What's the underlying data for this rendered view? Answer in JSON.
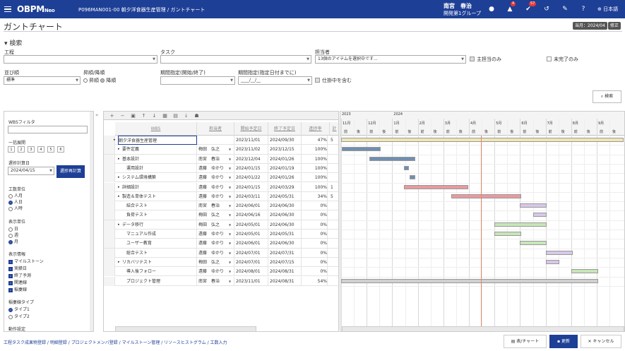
{
  "header": {
    "logo": "OBPM",
    "logo_suffix": "Neo",
    "breadcrumb": "P096MAN001-00 朝夕洋食器生産管理 / ガントチャート",
    "user_name": "南宮　春治",
    "user_group": "開発第1グループ",
    "badge_bell": "4",
    "badge_check": "57",
    "language": "日本語",
    "accent": "#1e3f96"
  },
  "page": {
    "title": "ガントチャート",
    "current_badge": "当月：2024/04",
    "fix_badge": "修正"
  },
  "search": {
    "section_title": "検索",
    "labels": {
      "process": "工程",
      "task": "タスク",
      "assignee": "担当者",
      "order": "並び順",
      "asc_desc": "昇順/降順",
      "period_range": "期間指定(開始/終了)",
      "period_date": "期間指定(指定日付までに)"
    },
    "assignee_value": "13個のアイテムを選択中です...",
    "only_mine": "主担当のみ",
    "only_incomplete": "未完了のみ",
    "order_value": "標準",
    "asc": "昇順",
    "desc": "降順",
    "date_placeholder": "____/__/__",
    "include_wip": "仕掛中を含む",
    "search_button": "検索"
  },
  "side": {
    "wbs_filter": "WBSフィルタ",
    "expand_all": "一括展開",
    "levels": [
      "1",
      "2",
      "3",
      "4",
      "5",
      "6"
    ],
    "delay_date_label": "遅捗計算日",
    "delay_date": "2024/04/15",
    "recalc": "遅捗再計算",
    "unit_label": "工数単位",
    "units": [
      "人月",
      "人日",
      "人時"
    ],
    "display_unit_label": "表示単位",
    "display_units": [
      "日",
      "週",
      "月"
    ],
    "display_info_label": "表示情報",
    "display_info": [
      "マイルストーン",
      "実績日",
      "終了予測",
      "関連線",
      "稲妻線"
    ],
    "lightning_label": "稲妻線タイプ",
    "lightning_types": [
      "タイプ1",
      "タイプ2"
    ],
    "action_settings": "動作設定"
  },
  "grid": {
    "columns": [
      "WBS",
      "担当者",
      "開始予定日",
      "終了予定日",
      "進捗率",
      "計"
    ],
    "rows": [
      {
        "wbs": "朝夕洋食器生産管理",
        "assignee": "",
        "start": "2023/11/01",
        "end": "2024/09/30",
        "progress": "47%",
        "extra": "5"
      },
      {
        "wbs": "要件定義",
        "assignee": "梅田　弘之",
        "start": "2023/11/02",
        "end": "2023/12/15",
        "progress": "100%",
        "extra": ""
      },
      {
        "wbs": "基本設計",
        "assignee": "南宮　春治",
        "start": "2023/12/04",
        "end": "2024/01/26",
        "progress": "100%",
        "extra": ""
      },
      {
        "wbs": "運用設計",
        "assignee": "遠藤　ゆかり",
        "start": "2024/01/15",
        "end": "2024/01/19",
        "progress": "100%",
        "extra": ""
      },
      {
        "wbs": "システム環境構築",
        "assignee": "遠藤　ゆかり",
        "start": "2024/01/22",
        "end": "2024/01/26",
        "progress": "100%",
        "extra": ""
      },
      {
        "wbs": "詳細設計",
        "assignee": "遠藤　ゆかり",
        "start": "2024/01/15",
        "end": "2024/03/29",
        "progress": "100%",
        "extra": "1"
      },
      {
        "wbs": "製造＆単体テスト",
        "assignee": "遠藤　ゆかり",
        "start": "2024/03/11",
        "end": "2024/05/31",
        "progress": "34%",
        "extra": "5"
      },
      {
        "wbs": "結合テスト",
        "assignee": "南宮　春治",
        "start": "2024/06/01",
        "end": "2024/06/30",
        "progress": "0%",
        "extra": ""
      },
      {
        "wbs": "負荷テスト",
        "assignee": "梅田　弘之",
        "start": "2024/06/16",
        "end": "2024/06/30",
        "progress": "0%",
        "extra": ""
      },
      {
        "wbs": "データ移行",
        "assignee": "梅田　弘之",
        "start": "2024/05/01",
        "end": "2024/06/30",
        "progress": "0%",
        "extra": ""
      },
      {
        "wbs": "マニュアル作成",
        "assignee": "遠藤　ゆかり",
        "start": "2024/05/01",
        "end": "2024/05/31",
        "progress": "0%",
        "extra": ""
      },
      {
        "wbs": "ユーザー教育",
        "assignee": "遠藤　ゆかり",
        "start": "2024/06/01",
        "end": "2024/06/30",
        "progress": "0%",
        "extra": ""
      },
      {
        "wbs": "総合テスト",
        "assignee": "遠藤　ゆかり",
        "start": "2024/07/01",
        "end": "2024/07/31",
        "progress": "0%",
        "extra": ""
      },
      {
        "wbs": "リカバリテスト",
        "assignee": "梅田　弘之",
        "start": "2024/07/01",
        "end": "2024/07/15",
        "progress": "0%",
        "extra": ""
      },
      {
        "wbs": "導入後フォロー",
        "assignee": "遠藤　ゆかり",
        "start": "2024/08/01",
        "end": "2024/08/31",
        "progress": "0%",
        "extra": ""
      },
      {
        "wbs": "プロジェクト管理",
        "assignee": "南宮　春治",
        "start": "2023/11/01",
        "end": "2024/08/31",
        "progress": "54%",
        "extra": ""
      }
    ]
  },
  "gantt": {
    "years": [
      "2023",
      "2024"
    ],
    "months": [
      "11月",
      "12月",
      "1月",
      "2月",
      "3月",
      "4月",
      "5月",
      "6月",
      "7月",
      "8月",
      "9月"
    ],
    "halves": [
      "前",
      "後"
    ],
    "colors": {
      "done": "#6f8fb0",
      "late": "#e89aa0",
      "plan": "#d8c8e8",
      "green": "#c8e6b8",
      "yellow": "#efe6b8",
      "gray": "#d0d0d0",
      "lightning": "#e08a6a"
    }
  },
  "footer": {
    "links": [
      "工程タスク成果物登録",
      "明細登録",
      "プロジェクトメンバ登録",
      "マイルストーン管理",
      "リソースヒストグラム",
      "工数入力"
    ],
    "btn_table": "表/チャート",
    "btn_update": "更新",
    "btn_cancel": "キャンセル"
  }
}
